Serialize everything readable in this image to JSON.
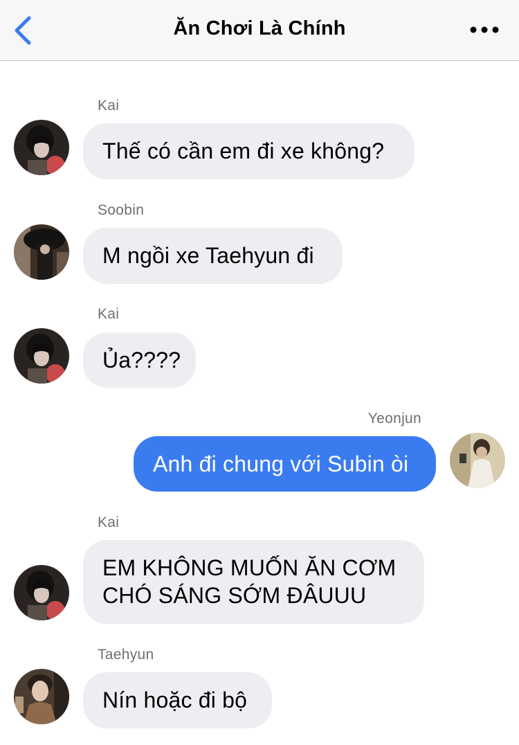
{
  "header": {
    "title": "Ăn Chơi Là Chính",
    "back_icon": "chevron-left-icon",
    "more_icon": "ellipsis-icon",
    "accent_color": "#3a7bf0"
  },
  "messages": [
    {
      "sender": "Kai",
      "text": "Thế có cần em đi xe không?",
      "direction": "incoming"
    },
    {
      "sender": "Soobin",
      "text": "M ngồi xe Taehyun đi",
      "direction": "incoming"
    },
    {
      "sender": "Kai",
      "text": "Ủa????",
      "direction": "incoming"
    },
    {
      "sender": "Yeonjun",
      "text": "Anh đi chung với Subin òi",
      "direction": "outgoing"
    },
    {
      "sender": "Kai",
      "text": "EM KHÔNG MUỐN ĂN CƠM CHÓ SÁNG SỚM ĐÂUUU",
      "lines": [
        "EM KHÔNG MUỐN ĂN CƠM",
        "CHÓ SÁNG SỚM ĐÂUUU"
      ],
      "direction": "incoming"
    },
    {
      "sender": "Taehyun",
      "text": "Nín hoặc đi bộ",
      "direction": "incoming"
    }
  ],
  "colors": {
    "incoming_bubble": "#eeeef2",
    "outgoing_bubble": "#3a7bf0"
  }
}
